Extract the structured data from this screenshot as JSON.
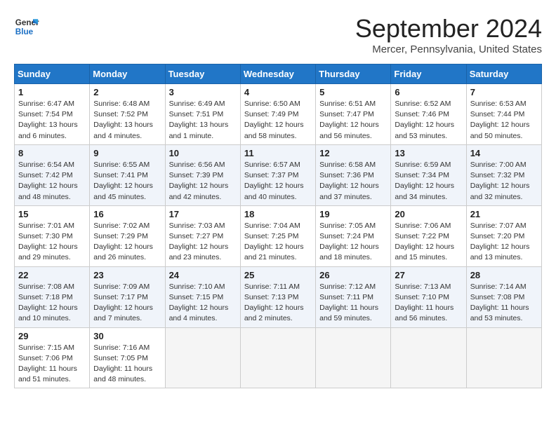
{
  "header": {
    "logo_line1": "General",
    "logo_line2": "Blue",
    "title": "September 2024",
    "subtitle": "Mercer, Pennsylvania, United States"
  },
  "calendar": {
    "headers": [
      "Sunday",
      "Monday",
      "Tuesday",
      "Wednesday",
      "Thursday",
      "Friday",
      "Saturday"
    ],
    "weeks": [
      [
        {
          "day": "1",
          "info": "Sunrise: 6:47 AM\nSunset: 7:54 PM\nDaylight: 13 hours and 6 minutes."
        },
        {
          "day": "2",
          "info": "Sunrise: 6:48 AM\nSunset: 7:52 PM\nDaylight: 13 hours and 4 minutes."
        },
        {
          "day": "3",
          "info": "Sunrise: 6:49 AM\nSunset: 7:51 PM\nDaylight: 13 hours and 1 minute."
        },
        {
          "day": "4",
          "info": "Sunrise: 6:50 AM\nSunset: 7:49 PM\nDaylight: 12 hours and 58 minutes."
        },
        {
          "day": "5",
          "info": "Sunrise: 6:51 AM\nSunset: 7:47 PM\nDaylight: 12 hours and 56 minutes."
        },
        {
          "day": "6",
          "info": "Sunrise: 6:52 AM\nSunset: 7:46 PM\nDaylight: 12 hours and 53 minutes."
        },
        {
          "day": "7",
          "info": "Sunrise: 6:53 AM\nSunset: 7:44 PM\nDaylight: 12 hours and 50 minutes."
        }
      ],
      [
        {
          "day": "8",
          "info": "Sunrise: 6:54 AM\nSunset: 7:42 PM\nDaylight: 12 hours and 48 minutes."
        },
        {
          "day": "9",
          "info": "Sunrise: 6:55 AM\nSunset: 7:41 PM\nDaylight: 12 hours and 45 minutes."
        },
        {
          "day": "10",
          "info": "Sunrise: 6:56 AM\nSunset: 7:39 PM\nDaylight: 12 hours and 42 minutes."
        },
        {
          "day": "11",
          "info": "Sunrise: 6:57 AM\nSunset: 7:37 PM\nDaylight: 12 hours and 40 minutes."
        },
        {
          "day": "12",
          "info": "Sunrise: 6:58 AM\nSunset: 7:36 PM\nDaylight: 12 hours and 37 minutes."
        },
        {
          "day": "13",
          "info": "Sunrise: 6:59 AM\nSunset: 7:34 PM\nDaylight: 12 hours and 34 minutes."
        },
        {
          "day": "14",
          "info": "Sunrise: 7:00 AM\nSunset: 7:32 PM\nDaylight: 12 hours and 32 minutes."
        }
      ],
      [
        {
          "day": "15",
          "info": "Sunrise: 7:01 AM\nSunset: 7:30 PM\nDaylight: 12 hours and 29 minutes."
        },
        {
          "day": "16",
          "info": "Sunrise: 7:02 AM\nSunset: 7:29 PM\nDaylight: 12 hours and 26 minutes."
        },
        {
          "day": "17",
          "info": "Sunrise: 7:03 AM\nSunset: 7:27 PM\nDaylight: 12 hours and 23 minutes."
        },
        {
          "day": "18",
          "info": "Sunrise: 7:04 AM\nSunset: 7:25 PM\nDaylight: 12 hours and 21 minutes."
        },
        {
          "day": "19",
          "info": "Sunrise: 7:05 AM\nSunset: 7:24 PM\nDaylight: 12 hours and 18 minutes."
        },
        {
          "day": "20",
          "info": "Sunrise: 7:06 AM\nSunset: 7:22 PM\nDaylight: 12 hours and 15 minutes."
        },
        {
          "day": "21",
          "info": "Sunrise: 7:07 AM\nSunset: 7:20 PM\nDaylight: 12 hours and 13 minutes."
        }
      ],
      [
        {
          "day": "22",
          "info": "Sunrise: 7:08 AM\nSunset: 7:18 PM\nDaylight: 12 hours and 10 minutes."
        },
        {
          "day": "23",
          "info": "Sunrise: 7:09 AM\nSunset: 7:17 PM\nDaylight: 12 hours and 7 minutes."
        },
        {
          "day": "24",
          "info": "Sunrise: 7:10 AM\nSunset: 7:15 PM\nDaylight: 12 hours and 4 minutes."
        },
        {
          "day": "25",
          "info": "Sunrise: 7:11 AM\nSunset: 7:13 PM\nDaylight: 12 hours and 2 minutes."
        },
        {
          "day": "26",
          "info": "Sunrise: 7:12 AM\nSunset: 7:11 PM\nDaylight: 11 hours and 59 minutes."
        },
        {
          "day": "27",
          "info": "Sunrise: 7:13 AM\nSunset: 7:10 PM\nDaylight: 11 hours and 56 minutes."
        },
        {
          "day": "28",
          "info": "Sunrise: 7:14 AM\nSunset: 7:08 PM\nDaylight: 11 hours and 53 minutes."
        }
      ],
      [
        {
          "day": "29",
          "info": "Sunrise: 7:15 AM\nSunset: 7:06 PM\nDaylight: 11 hours and 51 minutes."
        },
        {
          "day": "30",
          "info": "Sunrise: 7:16 AM\nSunset: 7:05 PM\nDaylight: 11 hours and 48 minutes."
        },
        {
          "day": "",
          "info": ""
        },
        {
          "day": "",
          "info": ""
        },
        {
          "day": "",
          "info": ""
        },
        {
          "day": "",
          "info": ""
        },
        {
          "day": "",
          "info": ""
        }
      ]
    ]
  }
}
